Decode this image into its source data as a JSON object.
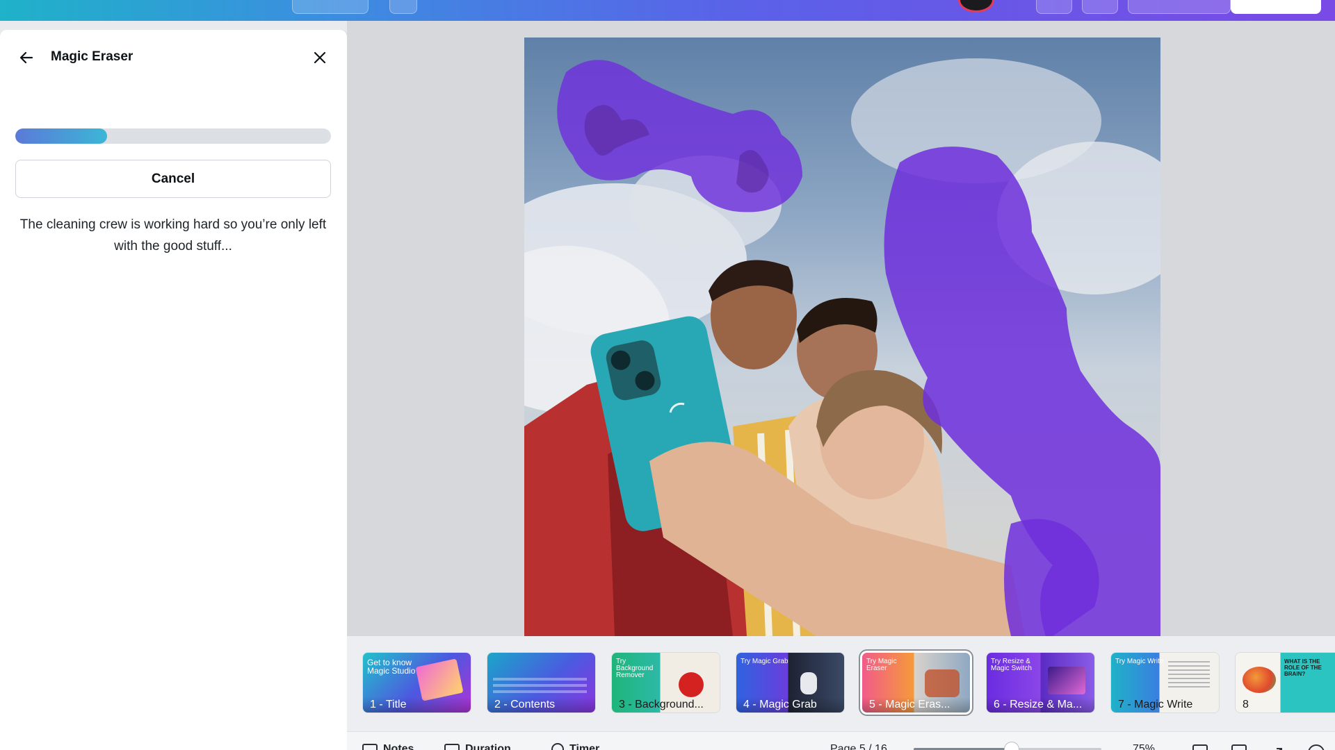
{
  "app": {
    "accent": "#7a49e6",
    "mask_color": "#6f2fdc"
  },
  "panel": {
    "title": "Magic Eraser",
    "back_icon": "arrow-left-icon",
    "close_icon": "close-icon",
    "progress": 0.29,
    "cancel_label": "Cancel",
    "status_text": "The cleaning crew is working hard so you’re only left with the good stuff..."
  },
  "thumbnails": [
    {
      "label": "1 - Title",
      "small": "Get to know Magic Studio"
    },
    {
      "label": "2 - Contents",
      "small": ""
    },
    {
      "label": "3 - Background...",
      "small": "Try Background Remover"
    },
    {
      "label": "4 - Magic Grab",
      "small": "Try Magic Grab"
    },
    {
      "label": "5 - Magic Eras...",
      "small": "Try Magic Eraser"
    },
    {
      "label": "6 - Resize & Ma...",
      "small": "Try Resize & Magic Switch"
    },
    {
      "label": "7 - Magic Write",
      "small": "Try Magic Write"
    },
    {
      "label": "8",
      "small": "WHAT IS THE ROLE OF THE BRAIN?"
    }
  ],
  "bottombar": {
    "notes": "Notes",
    "duration": "Duration",
    "timer": "Timer",
    "page": "Page 5 / 16",
    "zoom": "75%"
  }
}
